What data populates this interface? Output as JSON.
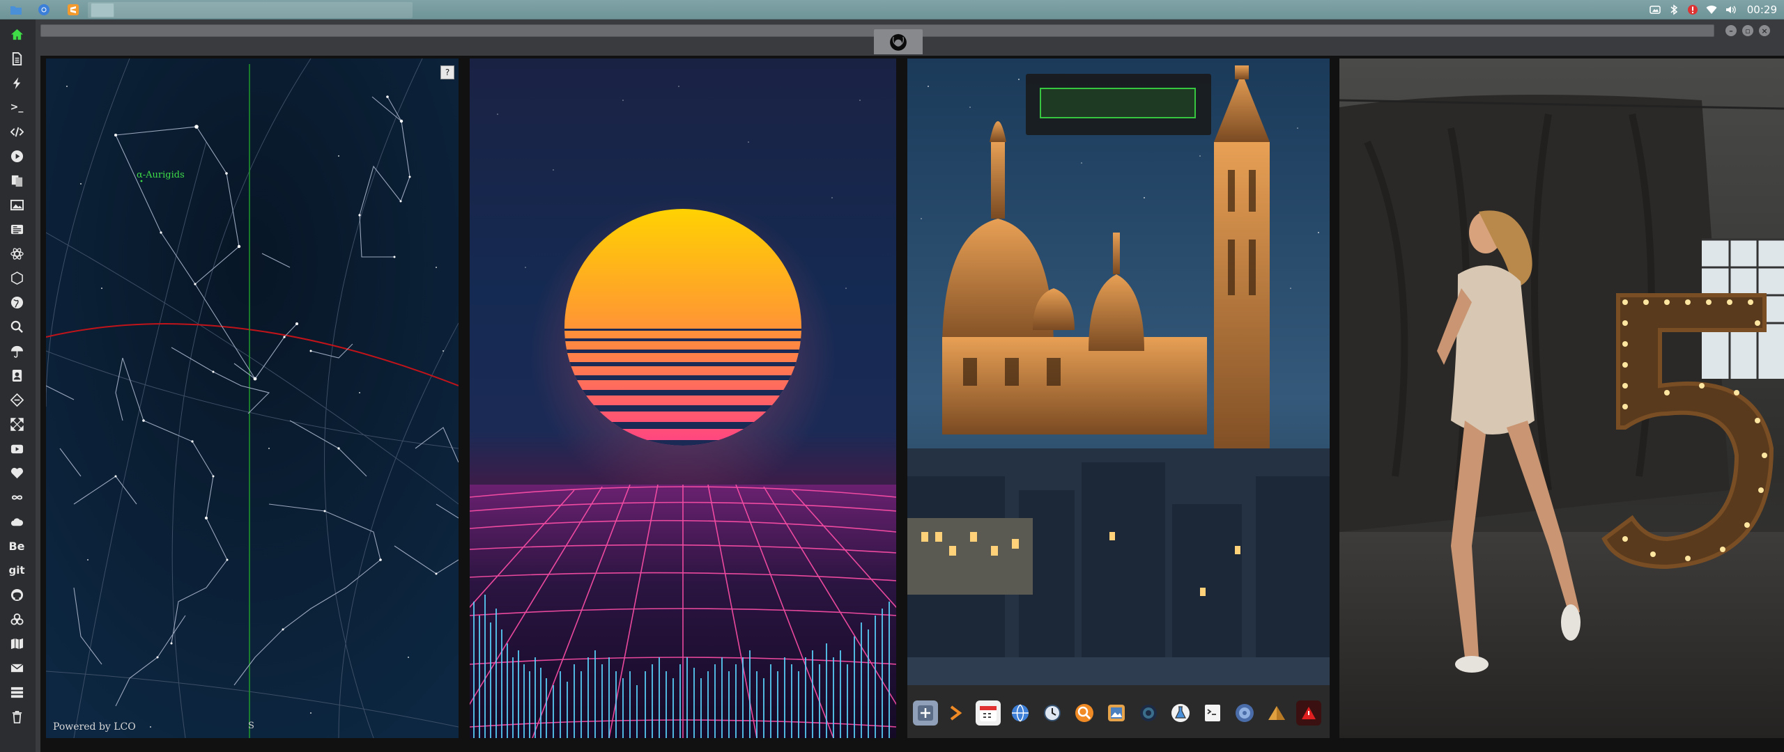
{
  "topbar": {
    "clock": "00:29",
    "apps": [
      "files-icon",
      "chrome-icon",
      "sublime-icon"
    ],
    "tray_icons": [
      "screenshot-icon",
      "bluetooth-icon",
      "alert-icon",
      "wifi-icon",
      "volume-icon"
    ]
  },
  "dock": {
    "items": [
      "home-icon",
      "document-icon",
      "bolt-icon",
      "terminal-icon",
      "code-icon",
      "play-icon",
      "files-icon",
      "image-icon",
      "news-icon",
      "react-icon",
      "hexagon-icon",
      "globe-icon",
      "search-icon",
      "umbrella-icon",
      "contacts-icon",
      "tag-icon",
      "expand-icon",
      "youtube-icon",
      "heart-icon",
      "infinity-icon",
      "cloud-icon",
      "behance-icon",
      "git-icon",
      "github-icon",
      "biohazard-icon",
      "map-icon",
      "mail-icon",
      "server-icon",
      "trash-icon"
    ],
    "behance_label": "Be",
    "git_label": "git",
    "terminal_label": ">_"
  },
  "window": {
    "tab_icon": "rebel-alliance-icon",
    "controls": [
      "minimize",
      "maximize",
      "close"
    ]
  },
  "starmap": {
    "help_label": "?",
    "meteor_shower": "α-Aurigids",
    "credit": "Powered by LCO",
    "cardinal": "S"
  },
  "city_dock": {
    "icons": [
      "add-icon",
      "terminal-arrow-icon",
      "calendar-icon",
      "globe-icon",
      "clock-icon",
      "search-icon",
      "photos-icon",
      "tor-icon",
      "flask-icon",
      "terminal-icon",
      "disk-icon",
      "pyramid-icon",
      "warning-icon"
    ]
  },
  "colors": {
    "accent_green": "#3fdc48",
    "ecliptic_red": "#c0141a",
    "synth_pink": "#ff4fa8",
    "synth_cyan": "#5ad6ff",
    "sun_yellow": "#ffd400"
  }
}
